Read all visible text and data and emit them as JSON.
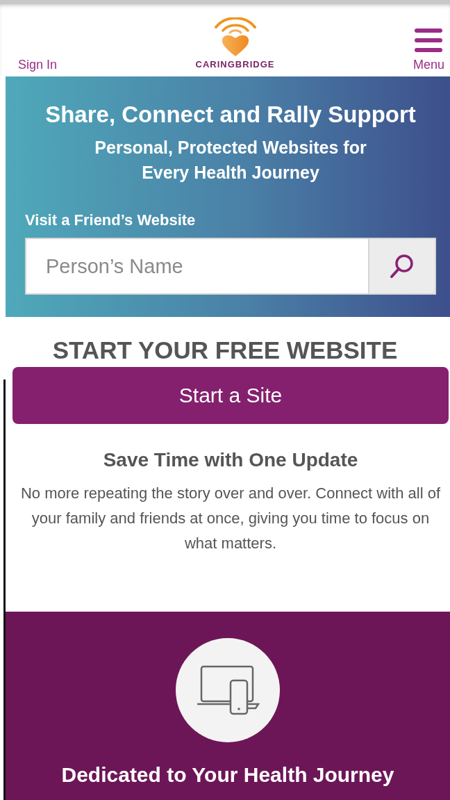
{
  "header": {
    "sign_in": "Sign In",
    "logo_text": "CARINGBRIDGE",
    "menu": "Menu"
  },
  "hero": {
    "title": "Share, Connect and Rally Support",
    "subtitle": "Personal, Protected Websites for Every Health Journey",
    "search_label": "Visit a Friend’s Website",
    "search": {
      "placeholder": "Person’s Name"
    }
  },
  "start": {
    "heading": "START YOUR FREE WEBSITE",
    "button": "Start a Site",
    "feature_title": "Save Time with One Update",
    "feature_text": "No more repeating the story over and over. Connect with all of your family and friends at once, giving you time to focus on what matters."
  },
  "dedicated": {
    "title": "Dedicated to Your Health Journey"
  }
}
